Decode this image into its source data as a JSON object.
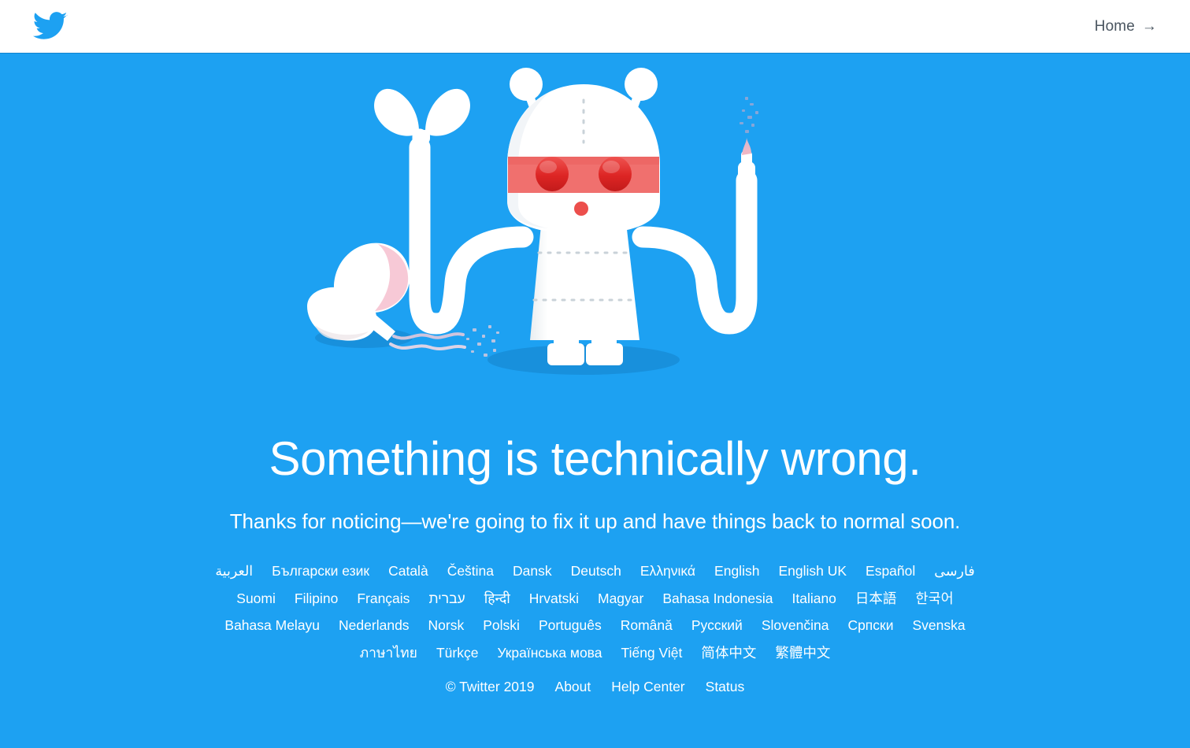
{
  "header": {
    "logo_icon": "twitter-bird-icon",
    "home_label": "Home",
    "home_arrow": "→"
  },
  "colors": {
    "brand_blue": "#1DA1F2",
    "header_bg": "#FFFFFF",
    "text_white": "#FFFFFF",
    "home_text": "#4A5560",
    "robot_white": "#FFFFFF",
    "visor_red": "#F0706E",
    "eye_red": "#DE2B2B",
    "shadow_blue": "#1890DC",
    "egg_pink": "#F7C9D6"
  },
  "illustration": {
    "name": "broken-robot-illustration",
    "parts": [
      "antenna-left",
      "antenna-right",
      "head",
      "visor",
      "eye-left",
      "eye-right",
      "mouth",
      "body",
      "leg-left",
      "leg-right",
      "arm-left",
      "arm-right",
      "pincer-claw",
      "smoking-tip",
      "cracked-ball",
      "smoke-particles",
      "ground-shadow"
    ]
  },
  "main": {
    "headline": "Something is technically wrong.",
    "subhead": "Thanks for noticing—we're going to fix it up and have things back to normal soon."
  },
  "languages": {
    "rows": [
      [
        "العربية",
        "Български език",
        "Català",
        "Čeština",
        "Dansk",
        "Deutsch",
        "Ελληνικά",
        "English",
        "English UK",
        "Español",
        "فارسی"
      ],
      [
        "Suomi",
        "Filipino",
        "Français",
        "עברית",
        "हिन्दी",
        "Hrvatski",
        "Magyar",
        "Bahasa Indonesia",
        "Italiano",
        "日本語",
        "한국어"
      ],
      [
        "Bahasa Melayu",
        "Nederlands",
        "Norsk",
        "Polski",
        "Português",
        "Română",
        "Русский",
        "Slovenčina",
        "Српски",
        "Svenska"
      ],
      [
        "ภาษาไทย",
        "Türkçe",
        "Українська мова",
        "Tiếng Việt",
        "简体中文",
        "繁體中文"
      ]
    ]
  },
  "footer": {
    "copyright": "© Twitter 2019",
    "links": [
      "About",
      "Help Center",
      "Status"
    ]
  }
}
